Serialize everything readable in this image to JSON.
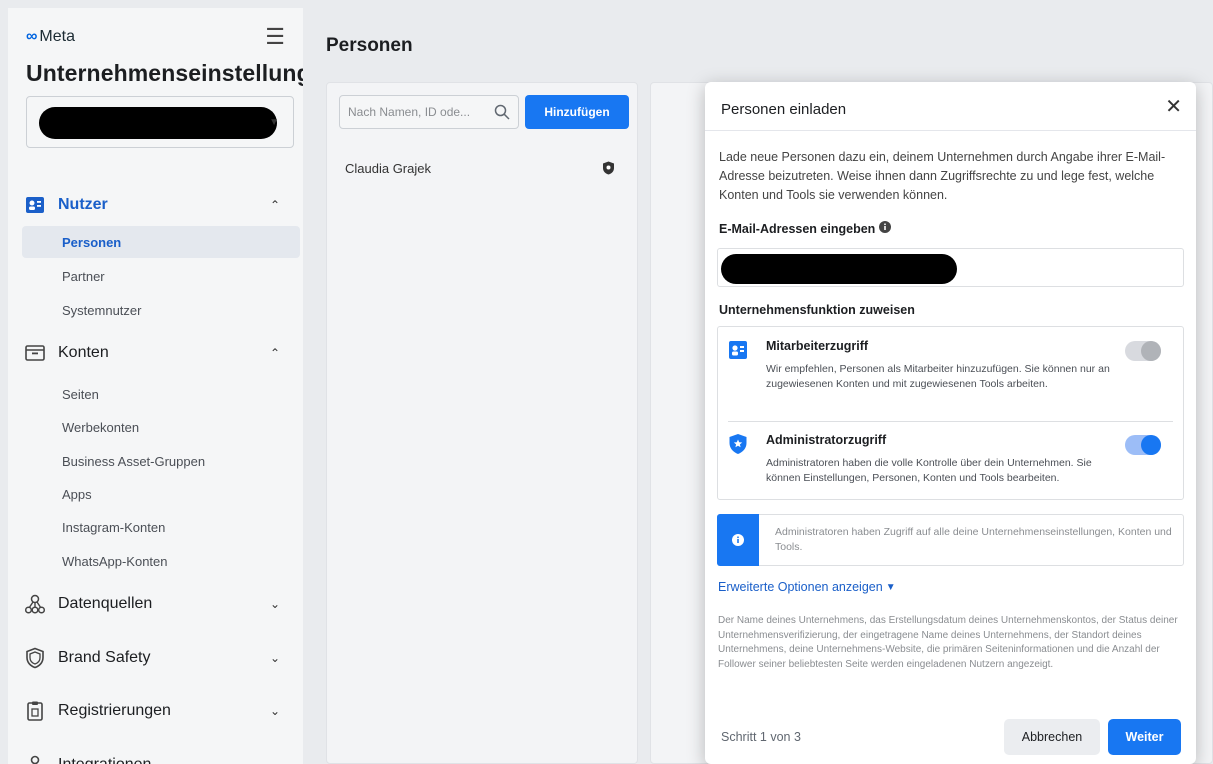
{
  "sidebar": {
    "logo_text": "Meta",
    "business_title": "Unternehmenseinstellunge",
    "sections": {
      "users": {
        "label": "Nutzer",
        "items": [
          "Personen",
          "Partner",
          "Systemnutzer"
        ]
      },
      "accounts": {
        "label": "Konten",
        "items": [
          "Seiten",
          "Werbekonten",
          "Business Asset-Gruppen",
          "Apps",
          "Instagram-Konten",
          "WhatsApp-Konten"
        ]
      },
      "data_sources": {
        "label": "Datenquellen"
      },
      "brand_safety": {
        "label": "Brand Safety"
      },
      "registrations": {
        "label": "Registrierungen"
      },
      "integrations": {
        "label": "Integrationen"
      }
    },
    "selected_item": "Personen"
  },
  "main": {
    "title": "Personen",
    "search_placeholder": "Nach Namen, ID ode...",
    "add_button": "Hinzufügen",
    "people": [
      {
        "name": "Claudia Grajek"
      }
    ]
  },
  "modal": {
    "title": "Personen einladen",
    "close_symbol": "✕",
    "intro": "Lade neue Personen dazu ein, deinem Unternehmen durch Angabe ihrer E-Mail-Adresse beizutreten. Weise ihnen dann Zugriffsrechte zu und lege fest, welche Konten und Tools sie verwenden können.",
    "email_label": "E-Mail-Adressen eingeben",
    "role_label": "Unternehmensfunktion zuweisen",
    "roles": [
      {
        "title": "Mitarbeiterzugriff",
        "description": "Wir empfehlen, Personen als Mitarbeiter hinzuzufügen. Sie können nur an zugewiesenen Konten und mit zugewiesenen Tools arbeiten.",
        "enabled": false
      },
      {
        "title": "Administratorzugriff",
        "description": "Administratoren haben die volle Kontrolle über dein Unternehmen. Sie können Einstellungen, Personen, Konten und Tools bearbeiten.",
        "enabled": true
      }
    ],
    "notice": "Administratoren haben Zugriff auf alle deine Unternehmenseinstellungen, Konten und Tools.",
    "advanced_link": "Erweiterte Optionen anzeigen",
    "disclaimer": "Der Name deines Unternehmens, das Erstellungsdatum deines Unternehmenskontos, der Status deiner Unternehmensverifizierung, der eingetragene Name deines Unternehmens, der Standort deines Unternehmens, deine Unternehmens-Website, die primären Seiteninformationen und die Anzahl der Follower seiner beliebtesten Seite werden eingeladenen Nutzern angezeigt.",
    "step": "Schritt 1 von 3",
    "cancel": "Abbrechen",
    "next": "Weiter"
  },
  "colors": {
    "accent": "#1877f2",
    "link": "#1a5fc9"
  }
}
